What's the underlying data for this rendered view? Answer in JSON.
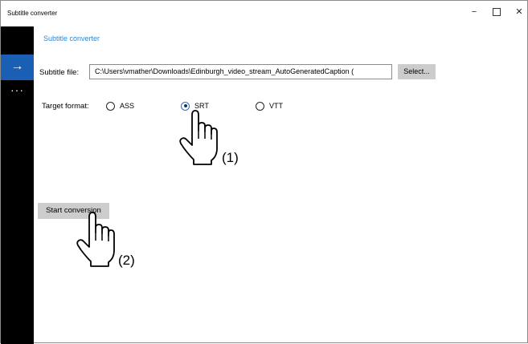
{
  "window": {
    "title": "Subtitle converter",
    "minimize_glyph": "−",
    "close_glyph": "✕"
  },
  "sidebar": {
    "arrow_glyph": "→",
    "more_glyph": "···",
    "accent_color": "#1a5fb4"
  },
  "page": {
    "header": "Subtitle converter",
    "file_label": "Subtitle file:",
    "file_value": "C:\\Users\\vmather\\Downloads\\Edinburgh_video_stream_AutoGeneratedCaption (",
    "select_button": "Select...",
    "format_label": "Target format:",
    "formats": [
      {
        "label": "ASS",
        "checked": false
      },
      {
        "label": "SRT",
        "checked": true
      },
      {
        "label": "VTT",
        "checked": false
      }
    ],
    "start_button": "Start conversion"
  },
  "annotations": {
    "step1": "(1)",
    "step2": "(2)"
  }
}
